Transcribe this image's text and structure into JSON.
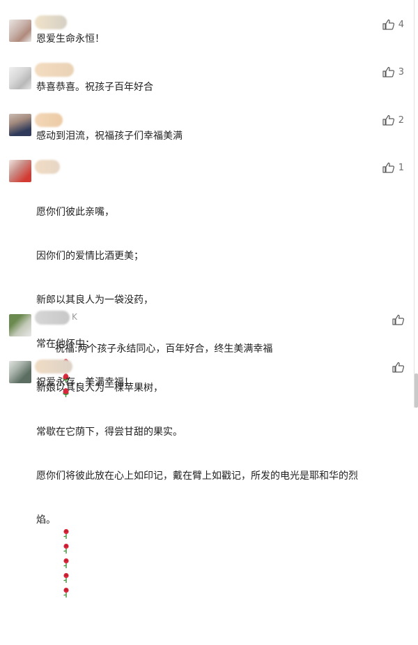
{
  "comments": [
    {
      "text": "恩爱生命永恒！",
      "likes": "4",
      "avatar_colors": [
        "#c7b0a8",
        "#b08a7c",
        "#e8e8e8"
      ],
      "nick_colors": [
        "#f1e3c9",
        "#d5cfc4"
      ]
    },
    {
      "text": "恭喜恭喜。祝孩子百年好合",
      "likes": "3",
      "avatar_colors": [
        "#d8d8d8",
        "#b9b9b9",
        "#efefef"
      ],
      "nick_colors": [
        "#f3dcc0",
        "#e9d2b5"
      ]
    },
    {
      "text": "感动到泪流，祝福孩子们幸福美满",
      "likes": "2",
      "avatar_colors": [
        "#2f3a5a",
        "#a48b7e",
        "#cbbcb3"
      ],
      "nick_colors": [
        "#f3d7b7",
        "#eccba6"
      ]
    },
    {
      "lines": [
        "愿你们彼此亲嘴，",
        "因你们的爱情比酒更美；",
        "新郎以其良人为一袋没药，",
        "常在他怀中；",
        "新娘以其良人为一棵苹果树，",
        "常歇在它荫下，得尝甘甜的果实。",
        "愿你们将彼此放在心上如印记，戴在臂上如戳记，所发的电光是耶和华的烈",
        "焰。"
      ],
      "likes": "1",
      "avatar_colors": [
        "#d33a32",
        "#c98d86",
        "#efe3de"
      ],
      "nick_colors": [
        "#f1dcc4",
        "#e7d6c6"
      ],
      "trailing_icons": [
        "rose-icon",
        "rose-icon",
        "rose-icon",
        "rose-icon",
        "rose-icon"
      ]
    },
    {
      "text": "祝福:两个孩子永结同心，百年好合，终生美满幸福",
      "likes": "",
      "nick_suffix": "K",
      "avatar_colors": [
        "#6b8a4f",
        "#c3c9b8",
        "#e8e8e8"
      ],
      "nick_colors": [
        "#d6d6d6",
        "#c8c8c8"
      ],
      "trailing_icons": [
        "rose-bud-icon",
        "rose-bud-icon",
        "rose-bud-icon"
      ]
    },
    {
      "text": "祝爱永存，美满幸福！",
      "likes": "",
      "avatar_colors": [
        "#5c6e62",
        "#a9b3ab",
        "#e2e4e2"
      ],
      "nick_colors": [
        "#f0dcc4",
        "#ddd2c6"
      ]
    }
  ],
  "colors": {
    "text": "#1f1f1f",
    "like_count": "#6f6f6f",
    "like_icon": "#5a5a5a",
    "rose_red": "#d8263a",
    "rose_green": "#3f8f3a"
  }
}
